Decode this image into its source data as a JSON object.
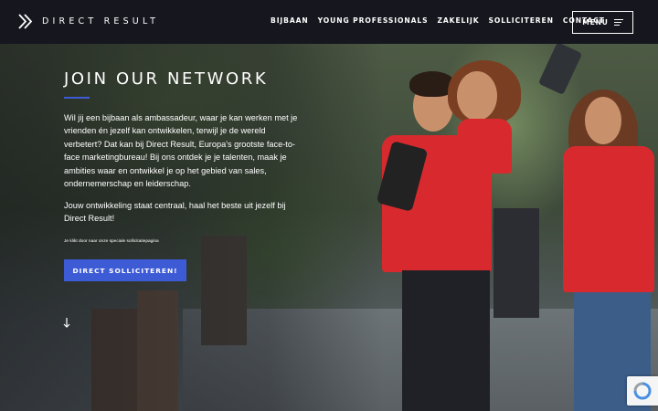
{
  "header": {
    "brand": "DIRECT RESULT",
    "nav": [
      "BIJBAAN",
      "YOUNG PROFESSIONALS",
      "ZAKELIJK",
      "SOLLICITEREN",
      "CONTACT"
    ],
    "menu_label": "MENU"
  },
  "hero": {
    "title": "JOIN OUR NETWORK",
    "paragraph1": "Wil jij een bijbaan als ambassadeur, waar je kan werken met je vrienden én jezelf kan ontwikkelen, terwijl je de wereld verbetert? Dat kan bij Direct Result, Europa's grootste face-to-face marketingbureau! Bij ons ontdek je je talenten, maak je ambities waar en ontwikkel je op het gebied van sales, ondernemerschap en leiderschap.",
    "paragraph2": "Jouw ontwikkeling staat centraal, haal het beste uit jezelf bij Direct Result!",
    "small_note": "Je klikt door naar onze speciale sollicitatiepagina",
    "cta_label": "DIRECT SOLLICITEREN!",
    "scroll_icon": "arrow-down-icon"
  },
  "colors": {
    "accent": "#3e5bd6",
    "header_bg": "#16161e",
    "shirt_red": "#d82a2e"
  },
  "icons": {
    "logo": "chevron-double-right-logo",
    "menu": "hamburger-icon",
    "captcha": "recaptcha-icon"
  }
}
